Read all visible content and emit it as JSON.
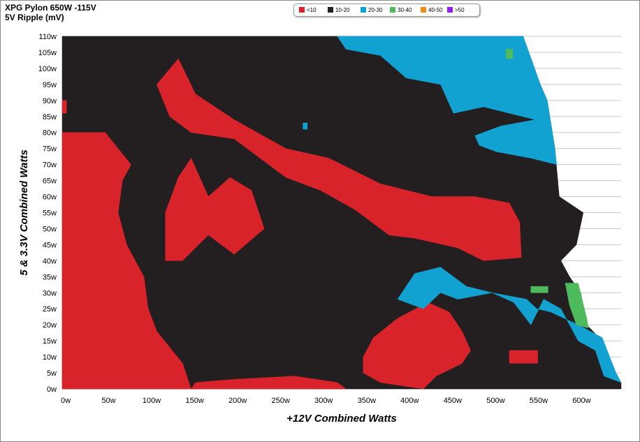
{
  "title": "XPG Pylon 650W -115V",
  "subtitle": "5V Ripple (mV)",
  "colors": {
    "lt10": "#d9232a",
    "10_20": "#231f20",
    "20_30": "#11a2d2",
    "30_40": "#4dba5c",
    "40_50": "#f08c1c",
    "gt50": "#8f1fe6",
    "grid": "#c8c8c8",
    "background": "#ffffff"
  },
  "legend": [
    {
      "label": "<10",
      "color": "#d9232a"
    },
    {
      "label": "10-20",
      "color": "#231f20"
    },
    {
      "label": "20-30",
      "color": "#11a2d2"
    },
    {
      "label": "30-40",
      "color": "#4dba5c"
    },
    {
      "label": "40-50",
      "color": "#f08c1c"
    },
    {
      "label": ">50",
      "color": "#8f1fe6"
    }
  ],
  "chart_data": {
    "type": "heatmap",
    "title": "XPG Pylon 650W -115V",
    "subtitle": "5V Ripple (mV)",
    "xlabel": "+12V Combined Watts",
    "ylabel": "5 & 3.3V Combined Watts",
    "xlim": [
      0,
      650
    ],
    "ylim": [
      0,
      110
    ],
    "x_ticks": [
      "0w",
      "50w",
      "100w",
      "150w",
      "200w",
      "250w",
      "300w",
      "350w",
      "400w",
      "450w",
      "500w",
      "550w",
      "600w"
    ],
    "y_ticks": [
      "0w",
      "5w",
      "10w",
      "15w",
      "20w",
      "25w",
      "30w",
      "35w",
      "40w",
      "45w",
      "50w",
      "55w",
      "60w",
      "65w",
      "70w",
      "75w",
      "80w",
      "85w",
      "90w",
      "95w",
      "100w",
      "105w",
      "110w"
    ],
    "grid": true,
    "legend_position": "top-center",
    "value_bins_mV": [
      "<10",
      "10-20",
      "20-30",
      "30-40",
      "40-50",
      ">50"
    ],
    "max_12v_load_by_5v_load": [
      {
        "v5": 0,
        "x_max": 650
      },
      {
        "v5": 5,
        "x_max": 644
      },
      {
        "v5": 15,
        "x_max": 628
      },
      {
        "v5": 20,
        "x_max": 610
      },
      {
        "v5": 30,
        "x_max": 603
      },
      {
        "v5": 35,
        "x_max": 590
      },
      {
        "v5": 40,
        "x_max": 580
      },
      {
        "v5": 45,
        "x_max": 598
      },
      {
        "v5": 55,
        "x_max": 606
      },
      {
        "v5": 60,
        "x_max": 578
      },
      {
        "v5": 75,
        "x_max": 573
      },
      {
        "v5": 90,
        "x_max": 564
      },
      {
        "v5": 95,
        "x_max": 556
      },
      {
        "v5": 110,
        "x_max": 536
      }
    ],
    "regions": [
      {
        "bin": "10-20",
        "desc": "baseline across the tested envelope",
        "polygon": [
          [
            0,
            0
          ],
          [
            650,
            0
          ],
          [
            650,
            2
          ],
          [
            644,
            5
          ],
          [
            628,
            15
          ],
          [
            610,
            20
          ],
          [
            603,
            30
          ],
          [
            590,
            35
          ],
          [
            580,
            40
          ],
          [
            598,
            45
          ],
          [
            606,
            55
          ],
          [
            578,
            60
          ],
          [
            573,
            75
          ],
          [
            564,
            90
          ],
          [
            556,
            95
          ],
          [
            536,
            110
          ],
          [
            0,
            110
          ]
        ]
      },
      {
        "bin": "<10",
        "desc": "left block at low +12V loads",
        "polygon": [
          [
            0,
            0
          ],
          [
            150,
            0
          ],
          [
            140,
            8
          ],
          [
            110,
            18
          ],
          [
            100,
            25
          ],
          [
            95,
            35
          ],
          [
            75,
            45
          ],
          [
            65,
            55
          ],
          [
            70,
            65
          ],
          [
            80,
            70
          ],
          [
            50,
            80
          ],
          [
            0,
            80
          ]
        ]
      },
      {
        "bin": "<10",
        "desc": "left-center lobe",
        "polygon": [
          [
            120,
            40
          ],
          [
            140,
            40
          ],
          [
            170,
            48
          ],
          [
            200,
            42
          ],
          [
            235,
            50
          ],
          [
            220,
            62
          ],
          [
            195,
            66
          ],
          [
            170,
            60
          ],
          [
            150,
            72
          ],
          [
            135,
            66
          ],
          [
            120,
            55
          ]
        ]
      },
      {
        "bin": "<10",
        "desc": "main diagonal band",
        "polygon": [
          [
            110,
            95
          ],
          [
            135,
            103
          ],
          [
            155,
            92
          ],
          [
            200,
            84
          ],
          [
            260,
            75
          ],
          [
            310,
            72
          ],
          [
            370,
            64
          ],
          [
            430,
            60
          ],
          [
            480,
            60
          ],
          [
            520,
            58
          ],
          [
            532,
            52
          ],
          [
            534,
            41
          ],
          [
            490,
            40
          ],
          [
            460,
            44
          ],
          [
            410,
            47
          ],
          [
            380,
            48
          ],
          [
            340,
            56
          ],
          [
            300,
            62
          ],
          [
            260,
            66
          ],
          [
            200,
            78
          ],
          [
            150,
            80
          ],
          [
            125,
            85
          ]
        ]
      },
      {
        "bin": "<10",
        "desc": "small upper-left spot",
        "polygon": [
          [
            0,
            90
          ],
          [
            5,
            90
          ],
          [
            5,
            86
          ],
          [
            0,
            86
          ]
        ]
      },
      {
        "bin": "<10",
        "desc": "lower-center blob",
        "polygon": [
          [
            350,
            5
          ],
          [
            370,
            2
          ],
          [
            420,
            0
          ],
          [
            435,
            4
          ],
          [
            465,
            8
          ],
          [
            475,
            12
          ],
          [
            465,
            18
          ],
          [
            450,
            24
          ],
          [
            425,
            27
          ],
          [
            390,
            22
          ],
          [
            362,
            16
          ],
          [
            350,
            10
          ]
        ]
      },
      {
        "bin": "<10",
        "desc": "bottom strip",
        "polygon": [
          [
            150,
            0
          ],
          [
            330,
            0
          ],
          [
            320,
            2
          ],
          [
            270,
            4
          ],
          [
            200,
            3
          ],
          [
            155,
            2
          ]
        ]
      },
      {
        "bin": "<10",
        "desc": "small block at right",
        "polygon": [
          [
            520,
            8
          ],
          [
            553,
            8
          ],
          [
            553,
            12
          ],
          [
            520,
            12
          ]
        ]
      },
      {
        "bin": "20-30",
        "desc": "upper-right band",
        "polygon": [
          [
            320,
            110
          ],
          [
            536,
            110
          ],
          [
            556,
            95
          ],
          [
            564,
            90
          ],
          [
            573,
            75
          ],
          [
            575,
            70
          ],
          [
            545,
            72
          ],
          [
            505,
            74
          ],
          [
            485,
            76
          ],
          [
            480,
            79
          ],
          [
            510,
            82
          ],
          [
            550,
            84
          ],
          [
            490,
            88
          ],
          [
            455,
            86
          ],
          [
            440,
            95
          ],
          [
            400,
            97
          ],
          [
            370,
            104
          ],
          [
            330,
            106
          ]
        ]
      },
      {
        "bin": "20-30",
        "desc": "right-side cluster",
        "polygon": [
          [
            390,
            28
          ],
          [
            420,
            25
          ],
          [
            440,
            30
          ],
          [
            460,
            28
          ],
          [
            500,
            30
          ],
          [
            540,
            28
          ],
          [
            552,
            25
          ],
          [
            568,
            24
          ],
          [
            600,
            20
          ],
          [
            628,
            16
          ],
          [
            644,
            5
          ],
          [
            650,
            2
          ],
          [
            630,
            4
          ],
          [
            620,
            12
          ],
          [
            600,
            15
          ],
          [
            580,
            25
          ],
          [
            560,
            28
          ],
          [
            545,
            20
          ],
          [
            525,
            27
          ],
          [
            500,
            30
          ],
          [
            470,
            32
          ],
          [
            440,
            38
          ],
          [
            410,
            36
          ]
        ]
      },
      {
        "bin": "20-30",
        "desc": "scattered specks",
        "polygon": [
          [
            280,
            83
          ],
          [
            285,
            83
          ],
          [
            285,
            81
          ],
          [
            280,
            81
          ]
        ]
      },
      {
        "bin": "30-40",
        "desc": "green patch near x 590-610",
        "polygon": [
          [
            585,
            33
          ],
          [
            600,
            33
          ],
          [
            610,
            22
          ],
          [
            612,
            19
          ],
          [
            598,
            20
          ],
          [
            590,
            26
          ]
        ]
      },
      {
        "bin": "30-40",
        "desc": "green patch at x 545-565",
        "polygon": [
          [
            545,
            32
          ],
          [
            565,
            32
          ],
          [
            565,
            30
          ],
          [
            545,
            30
          ]
        ]
      },
      {
        "bin": "30-40",
        "desc": "green speck near top right",
        "polygon": [
          [
            516,
            106
          ],
          [
            524,
            106
          ],
          [
            524,
            103
          ],
          [
            516,
            103
          ]
        ]
      }
    ]
  }
}
